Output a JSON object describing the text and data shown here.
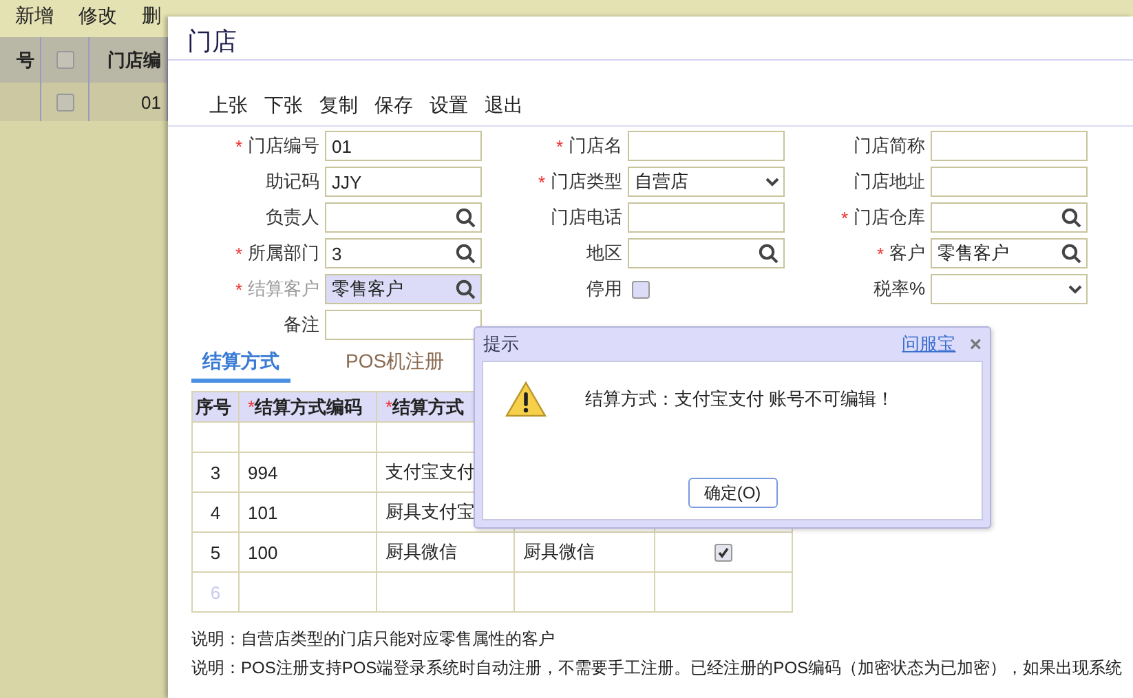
{
  "menu": [
    {
      "label": "新增"
    },
    {
      "label": "修改"
    },
    {
      "label": "删"
    }
  ],
  "background_list": {
    "header_number": "号",
    "header_checked": false,
    "header_code": "门店编",
    "rows": [
      {
        "checked": false,
        "code": "01"
      }
    ]
  },
  "window": {
    "title": "门店",
    "toolbar": [
      "上张",
      "下张",
      "复制",
      "保存",
      "设置",
      "退出"
    ],
    "fields": [
      {
        "kind": "text",
        "label": "门店编号",
        "required_mark": "*",
        "value": "01",
        "readonly": false
      },
      {
        "kind": "text",
        "label": "门店名",
        "required_mark": "*",
        "readonly": false
      },
      {
        "kind": "text",
        "label": "门店简称",
        "readonly": false
      },
      {
        "kind": "text",
        "label": "助记码",
        "value": "JJY",
        "readonly": false
      },
      {
        "kind": "select",
        "label": "门店类型",
        "required_mark": "*",
        "value": "自营店",
        "readonly": false
      },
      {
        "kind": "text",
        "label": "门店地址",
        "readonly": false
      },
      {
        "kind": "lookup",
        "label": "负责人",
        "readonly": false
      },
      {
        "kind": "text",
        "label": "门店电话",
        "readonly": false
      },
      {
        "kind": "lookup",
        "label": "门店仓库",
        "required_mark": "*",
        "readonly": false
      },
      {
        "kind": "lookup",
        "label": "所属部门",
        "required_mark": "*",
        "value": "3",
        "readonly": false
      },
      {
        "kind": "lookup",
        "label": "地区",
        "readonly": false
      },
      {
        "kind": "lookup",
        "label": "客户",
        "required_mark": "*",
        "value": "零售客户",
        "readonly": false
      },
      {
        "kind": "lookup",
        "label": "结算客户",
        "required_mark": "*",
        "value": "零售客户",
        "readonly": true
      },
      {
        "kind": "checkbox",
        "label": "停用",
        "checked": false,
        "readonly": false
      },
      {
        "kind": "select",
        "label": "税率%",
        "readonly": false
      },
      {
        "kind": "text",
        "label": "备注",
        "readonly": false
      }
    ],
    "tabs": [
      {
        "label": "结算方式",
        "selected": true
      },
      {
        "label": "POS机注册",
        "selected": false
      }
    ],
    "table": {
      "columns": [
        {
          "label": "序号"
        },
        {
          "label": "结算方式编码",
          "required_mark": "*"
        },
        {
          "label": "结算方式",
          "required_mark": "*"
        }
      ],
      "rows": [
        {
          "kind": "data",
          "number": "3",
          "code": "994",
          "name": "支付宝支付"
        },
        {
          "kind": "data",
          "number": "4",
          "code": "101",
          "name": "厨具支付宝"
        },
        {
          "kind": "data",
          "number": "5",
          "code": "100",
          "name": "厨具微信",
          "column_4": "厨具微信",
          "checked": true
        },
        {
          "kind": "new",
          "number": "6"
        }
      ]
    },
    "notes": [
      "说明：自营店类型的门店只能对应零售属性的客户",
      "说明：POS注册支持POS端登录系统时自动注册，不需要手工注册。已经注册的POS编码（加密状态为已加密），如果出现系统"
    ]
  },
  "dialog": {
    "title": "提示",
    "link": "问服宝",
    "close": "×",
    "message": "结算方式：支付宝支付 账号不可编辑！",
    "button": "确定(O)"
  }
}
